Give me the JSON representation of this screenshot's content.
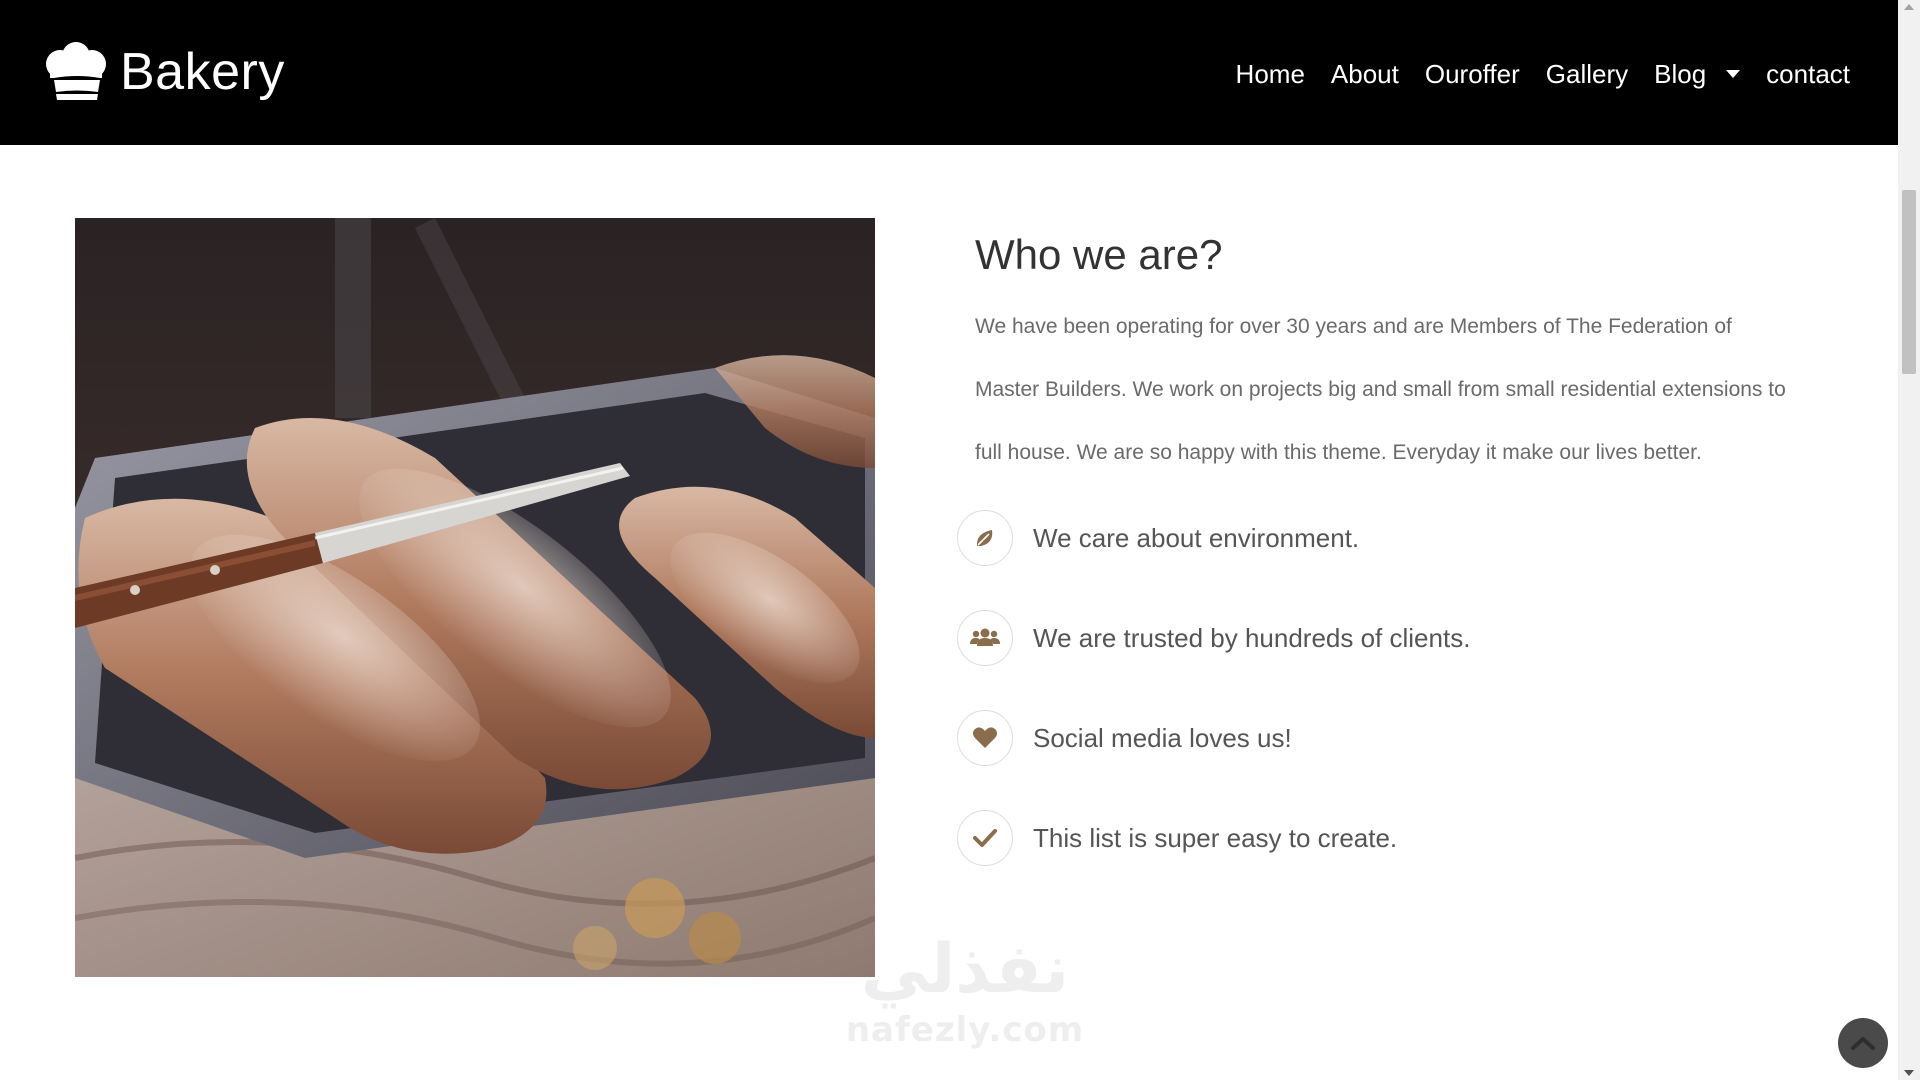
{
  "brand": {
    "name": "Bakery",
    "logo_icon": "chef-hat-icon"
  },
  "nav": {
    "items": [
      {
        "label": "Home"
      },
      {
        "label": "About"
      },
      {
        "label": "Ouroffer"
      },
      {
        "label": "Gallery"
      },
      {
        "label": "Blog",
        "has_dropdown": true
      },
      {
        "label": "contact"
      }
    ]
  },
  "about": {
    "title": "Who we are?",
    "paragraph": "We have been operating for over 30 years and are Members of The Federation of Master Builders. We work on projects big and small from small residential extensions to full house. We are so happy with this theme. Everyday it make our lives better.",
    "image_alt": "bread-loaves-on-tray-photo",
    "features": [
      {
        "icon": "leaf-icon",
        "text": "We care about environment."
      },
      {
        "icon": "users-icon",
        "text": "We are trusted by hundreds of clients."
      },
      {
        "icon": "heart-icon",
        "text": "Social media loves us!"
      },
      {
        "icon": "check-icon",
        "text": "This list is super easy to create."
      }
    ]
  },
  "watermark": {
    "arabic": "نفذلي",
    "latin": "nafezly.com"
  },
  "back_to_top_icon": "chevron-up-icon",
  "colors": {
    "navbar_bg": "#000000",
    "accent_brown": "#8a6d4b",
    "heading": "#333333",
    "body_text": "#6a6a6a"
  }
}
